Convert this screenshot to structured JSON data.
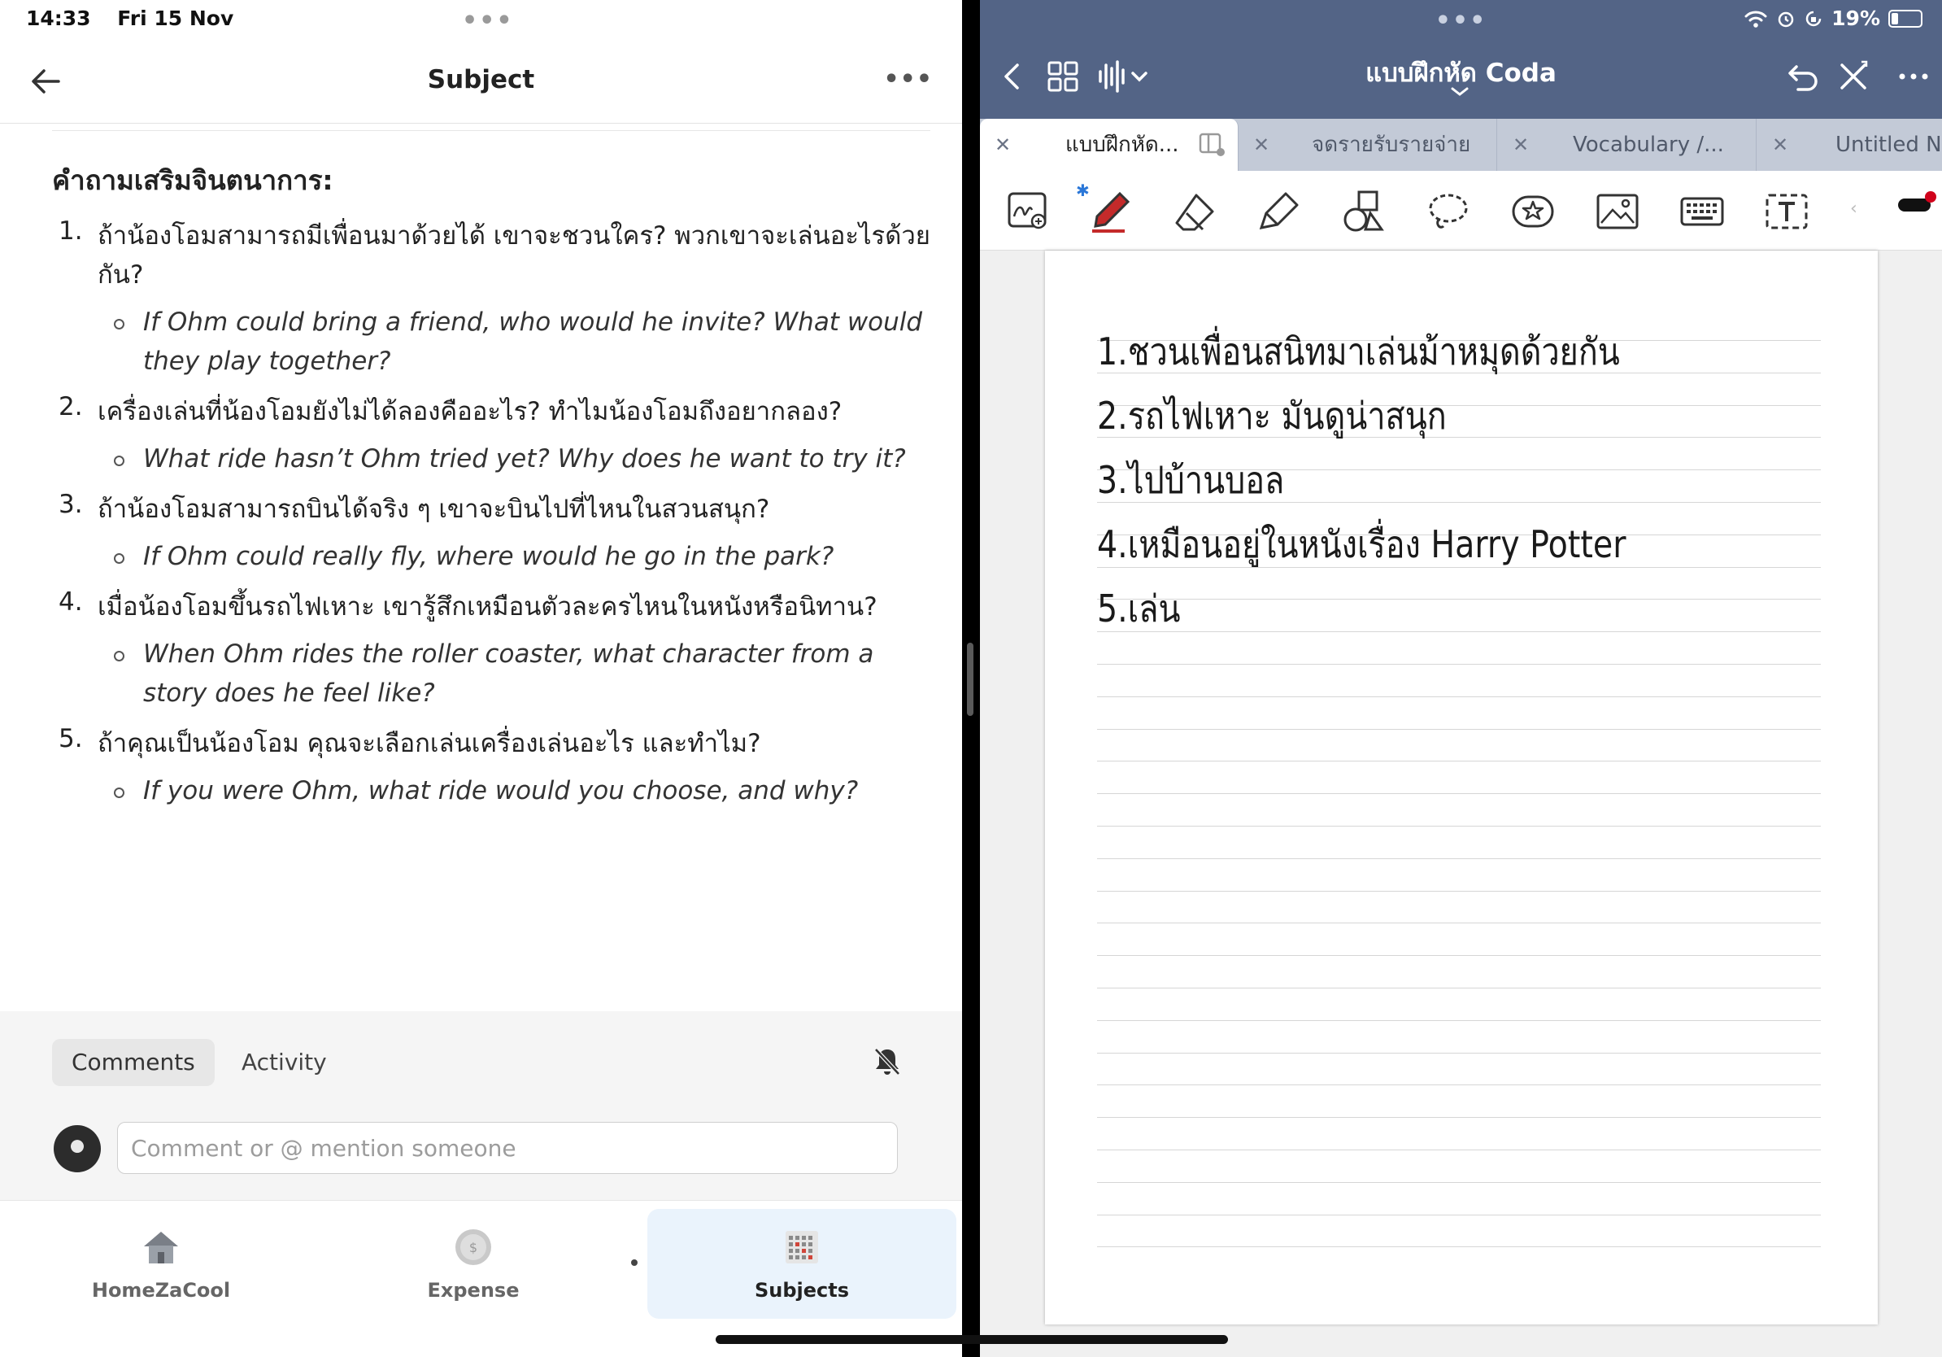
{
  "left_pane": {
    "status": {
      "time": "14:33",
      "date": "Fri 15 Nov"
    },
    "nav": {
      "title": "Subject"
    },
    "section_heading": "คำถามเสริมจินตนาการ:",
    "questions": [
      {
        "num": "1.",
        "th": "ถ้าน้องโอมสามารถมีเพื่อนมาด้วยได้ เขาจะชวนใคร? พวกเขาจะเล่นอะไรด้วยกัน?",
        "en": "If Ohm could bring a friend, who would he invite? What would they play together?"
      },
      {
        "num": "2.",
        "th": "เครื่องเล่นที่น้องโอมยังไม่ได้ลองคืออะไร? ทำไมน้องโอมถึงอยากลอง?",
        "en": "What ride hasn’t Ohm tried yet? Why does he want to try it?"
      },
      {
        "num": "3.",
        "th": "ถ้าน้องโอมสามารถบินได้จริง ๆ เขาจะบินไปที่ไหนในสวนสนุก?",
        "en": "If Ohm could really fly, where would he go in the park?"
      },
      {
        "num": "4.",
        "th": "เมื่อน้องโอมขึ้นรถไฟเหาะ เขารู้สึกเหมือนตัวละครไหนในหนังหรือนิทาน?",
        "en": "When Ohm rides the roller coaster, what character from a story does he feel like?"
      },
      {
        "num": "5.",
        "th": "ถ้าคุณเป็นน้องโอม คุณจะเลือกเล่นเครื่องเล่นอะไร และทำไม?",
        "en": "If you were Ohm, what ride would you choose, and why?"
      }
    ],
    "comments": {
      "tab_comments": "Comments",
      "tab_activity": "Activity",
      "placeholder": "Comment or @ mention someone"
    },
    "bottom_tabs": [
      {
        "label": "HomeZaCool",
        "icon": "house-icon"
      },
      {
        "label": "Expense",
        "icon": "coin-icon"
      },
      {
        "label": "Subjects",
        "icon": "calendar-grid-icon"
      }
    ]
  },
  "right_pane": {
    "status": {
      "battery": "19%"
    },
    "doc_title": "แบบฝึกหัด Coda",
    "tabs": [
      {
        "label": "แบบฝึกหัด...",
        "active": true
      },
      {
        "label": "จดรายรับรายจ่าย",
        "active": false
      },
      {
        "label": "Vocabulary /...",
        "active": false
      },
      {
        "label": "Untitled N",
        "active": false
      }
    ],
    "handwriting": [
      "1.ชวนเพื่อนสนิทมาเล่นม้าหมุดด้วยกัน",
      "2.รถไฟเหาะ มันดูน่าสนุก",
      "3.ไปบ้านบอล",
      "4.เหมือนอยู่ในหนังเรื่อง Harry Potter",
      "5.เล่น"
    ],
    "colors": {
      "header": "#536486",
      "tabs": "#c3cad7",
      "pen": "#c42a2a",
      "accent_red": "#d0021b"
    }
  }
}
